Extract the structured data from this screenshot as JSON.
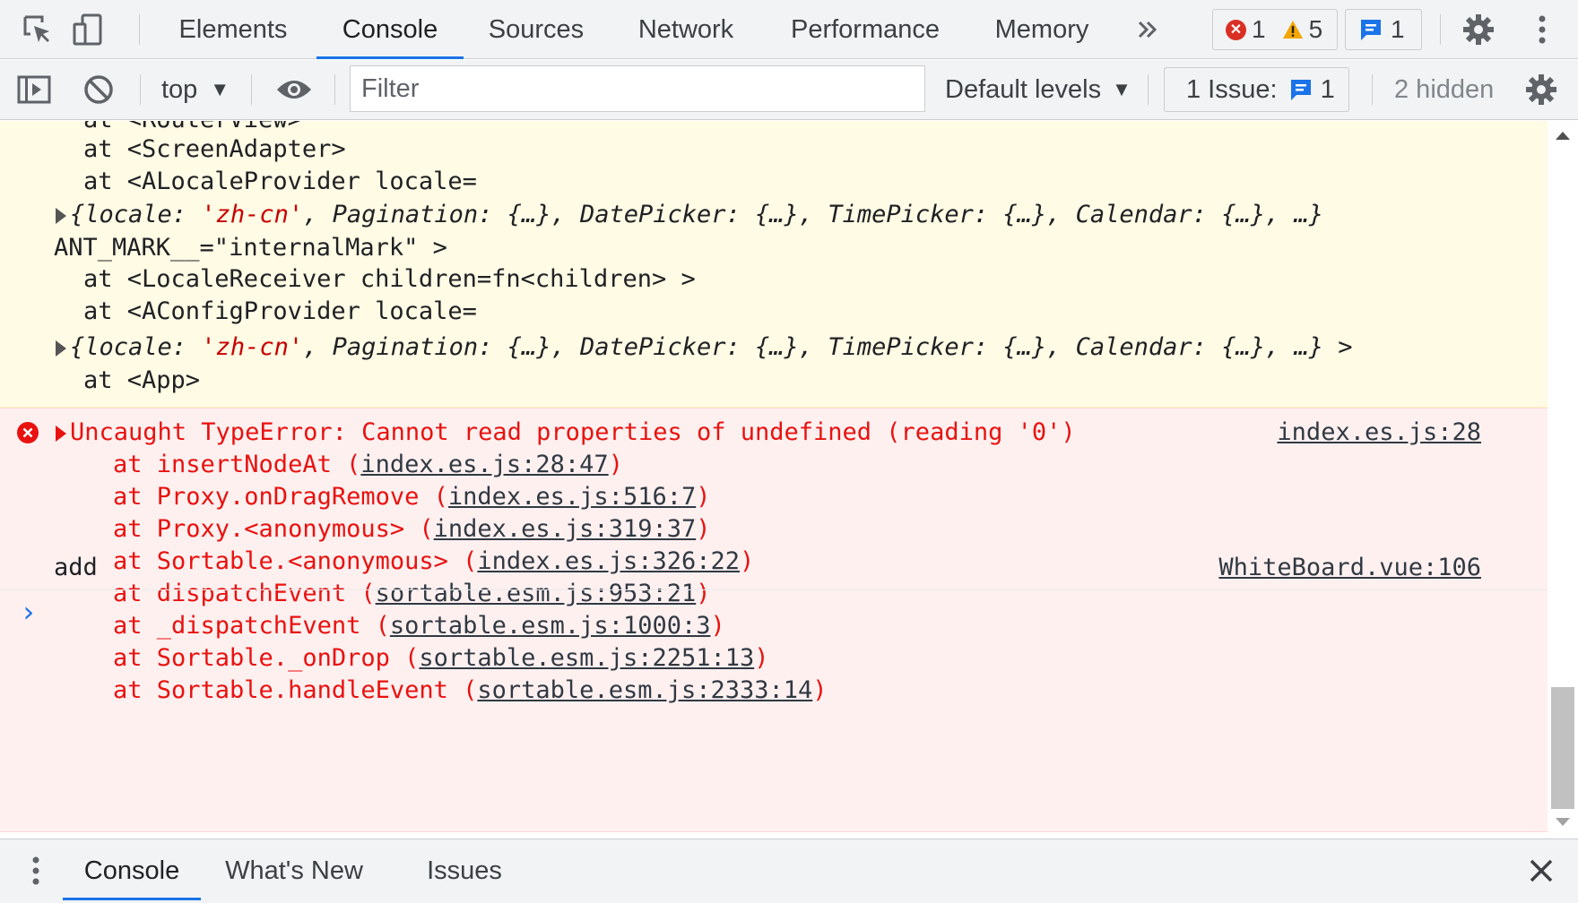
{
  "main_tabs": [
    {
      "label": "Elements"
    },
    {
      "label": "Console"
    },
    {
      "label": "Sources"
    },
    {
      "label": "Network"
    },
    {
      "label": "Performance"
    },
    {
      "label": "Memory"
    }
  ],
  "more_tabs_icon": "chevron-double-right",
  "counters": {
    "errors": "1",
    "warnings": "5",
    "messages": "1"
  },
  "toolbar": {
    "context": "top",
    "filter_placeholder": "Filter",
    "levels": "Default levels",
    "issues_label": "1 Issue:",
    "issues_count": "1",
    "hidden": "2 hidden"
  },
  "warning": {
    "lines": [
      "at <RouterView>",
      "at <ScreenAdapter>",
      "at <ALocaleProvider locale="
    ],
    "obj1": {
      "open": "{",
      "k1": "locale: ",
      "v1": "'zh-cn'",
      "rest": ", Pagination: {…}, DatePicker: {…}, TimePicker: {…}, Calendar: {…}, …}"
    },
    "mark_line": "ANT_MARK__=\"internalMark\" >",
    "line_receiver": "at <LocaleReceiver children=fn<children> >",
    "line_config": "at <AConfigProvider locale=",
    "obj2_tail": " >",
    "line_app": "at <App>"
  },
  "error": {
    "message": "Uncaught TypeError: Cannot read properties of undefined (reading '0')",
    "source": "index.es.js:28",
    "stack": [
      {
        "fn": "at insertNodeAt (",
        "loc": "index.es.js:28:47",
        "end": ")"
      },
      {
        "fn": "at Proxy.onDragRemove (",
        "loc": "index.es.js:516:7",
        "end": ")"
      },
      {
        "fn": "at Proxy.<anonymous> (",
        "loc": "index.es.js:319:37",
        "end": ")"
      },
      {
        "fn": "at Sortable.<anonymous> (",
        "loc": "index.es.js:326:22",
        "end": ")"
      },
      {
        "fn": "at dispatchEvent (",
        "loc": "sortable.esm.js:953:21",
        "end": ")"
      },
      {
        "fn": "at _dispatchEvent (",
        "loc": "sortable.esm.js:1000:3",
        "end": ")"
      },
      {
        "fn": "at Sortable._onDrop (",
        "loc": "sortable.esm.js:2251:13",
        "end": ")"
      },
      {
        "fn": "at Sortable.handleEvent (",
        "loc": "sortable.esm.js:2333:14",
        "end": ")"
      }
    ]
  },
  "log": {
    "text": "add",
    "source": "WhiteBoard.vue:106"
  },
  "prompt_symbol": "›",
  "drawer": {
    "tabs": [
      {
        "label": "Console"
      },
      {
        "label": "What's New"
      },
      {
        "label": "Issues"
      }
    ]
  },
  "colors": {
    "accent": "#1a73e8",
    "error_text": "#e8120f",
    "error_bg": "#fff0f0",
    "warning_bg": "#fffbe5",
    "warning_icon": "#f2a600",
    "error_icon": "#d93025"
  }
}
